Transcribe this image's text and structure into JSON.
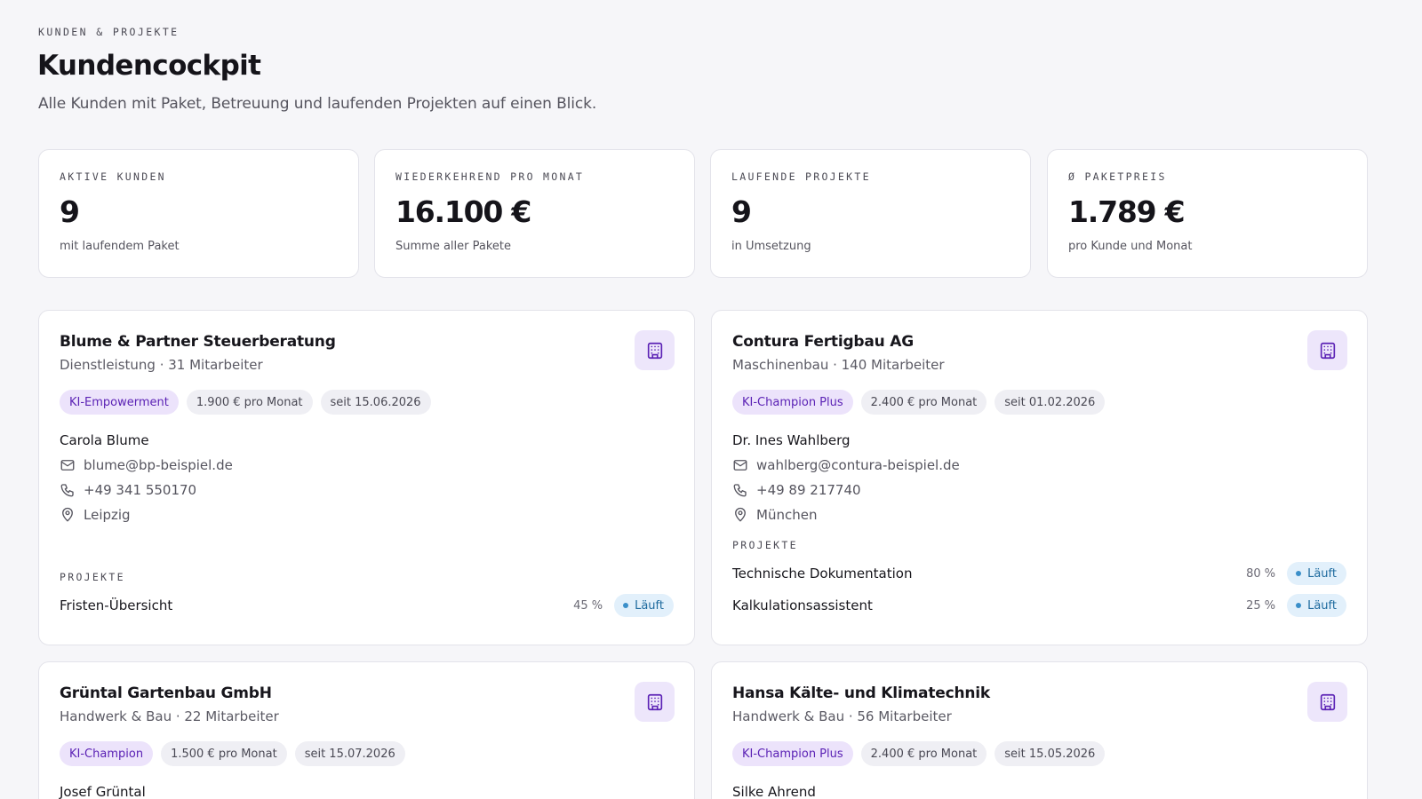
{
  "header": {
    "eyebrow": "KUNDEN & PROJEKTE",
    "title": "Kundencockpit",
    "subtitle": "Alle Kunden mit Paket, Betreuung und laufenden Projekten auf einen Blick."
  },
  "kpis": [
    {
      "label": "AKTIVE KUNDEN",
      "value": "9",
      "caption": "mit laufendem Paket"
    },
    {
      "label": "WIEDERKEHREND PRO MONAT",
      "value": "16.100 €",
      "caption": "Summe aller Pakete"
    },
    {
      "label": "LAUFENDE PROJEKTE",
      "value": "9",
      "caption": "in Umsetzung"
    },
    {
      "label": "Ø PAKETPREIS",
      "value": "1.789 €",
      "caption": "pro Kunde und Monat"
    }
  ],
  "projects_label": "PROJEKTE",
  "customers": [
    {
      "name": "Blume & Partner Steuerberatung",
      "meta": "Dienstleistung · 31 Mitarbeiter",
      "package": "KI-Empowerment",
      "price": "1.900 € pro Monat",
      "since": "seit 15.06.2026",
      "contact": "Carola Blume",
      "email": "blume@bp-beispiel.de",
      "phone": "+49 341 550170",
      "city": "Leipzig",
      "projects": [
        {
          "name": "Fristen-Übersicht",
          "progress": "45 %",
          "status": "Läuft"
        }
      ]
    },
    {
      "name": "Contura Fertigbau AG",
      "meta": "Maschinenbau · 140 Mitarbeiter",
      "package": "KI-Champion Plus",
      "price": "2.400 € pro Monat",
      "since": "seit 01.02.2026",
      "contact": "Dr. Ines Wahlberg",
      "email": "wahlberg@contura-beispiel.de",
      "phone": "+49 89 217740",
      "city": "München",
      "projects": [
        {
          "name": "Technische Dokumentation",
          "progress": "80 %",
          "status": "Läuft"
        },
        {
          "name": "Kalkulationsassistent",
          "progress": "25 %",
          "status": "Läuft"
        }
      ]
    },
    {
      "name": "Grüntal Gartenbau GmbH",
      "meta": "Handwerk & Bau · 22 Mitarbeiter",
      "package": "KI-Champion",
      "price": "1.500 € pro Monat",
      "since": "seit 15.07.2026",
      "contact": "Josef Grüntal"
    },
    {
      "name": "Hansa Kälte- und Klimatechnik",
      "meta": "Handwerk & Bau · 56 Mitarbeiter",
      "package": "KI-Champion Plus",
      "price": "2.400 € pro Monat",
      "since": "seit 15.05.2026",
      "contact": "Silke Ahrend"
    }
  ],
  "icons": {
    "building": "building-icon",
    "mail": "mail-icon",
    "phone": "phone-icon",
    "location": "map-pin-icon"
  },
  "colors": {
    "accent": "#5b22b5",
    "accent_bg": "#ede6fb",
    "status": "#1d6a9e",
    "status_bg": "#e2f0fb",
    "background": "#f6f6f9"
  }
}
